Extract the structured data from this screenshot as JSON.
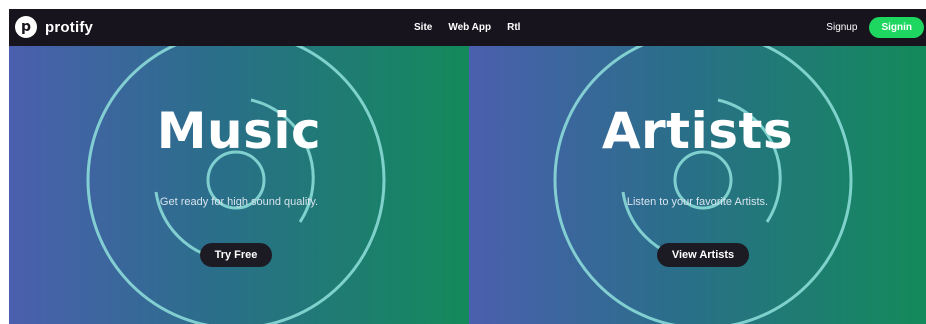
{
  "brand": {
    "mark": "p",
    "name": "protify"
  },
  "nav": {
    "links": [
      "Site",
      "Web App",
      "Rtl"
    ]
  },
  "auth": {
    "signup": "Signup",
    "signin": "Signin"
  },
  "panels": [
    {
      "title": "Music",
      "subtitle": "Get ready for high sound quality.",
      "cta": "Try Free"
    },
    {
      "title": "Artists",
      "subtitle": "Listen to your favorite Artists.",
      "cta": "View Artists"
    }
  ],
  "colors": {
    "navbar_bg": "#17141d",
    "accent_green": "#1ed760",
    "gradient_start": "#4b5fae",
    "gradient_end": "#138a5a",
    "ring": "#8fe0dc",
    "button_dark": "#1c1a22"
  }
}
